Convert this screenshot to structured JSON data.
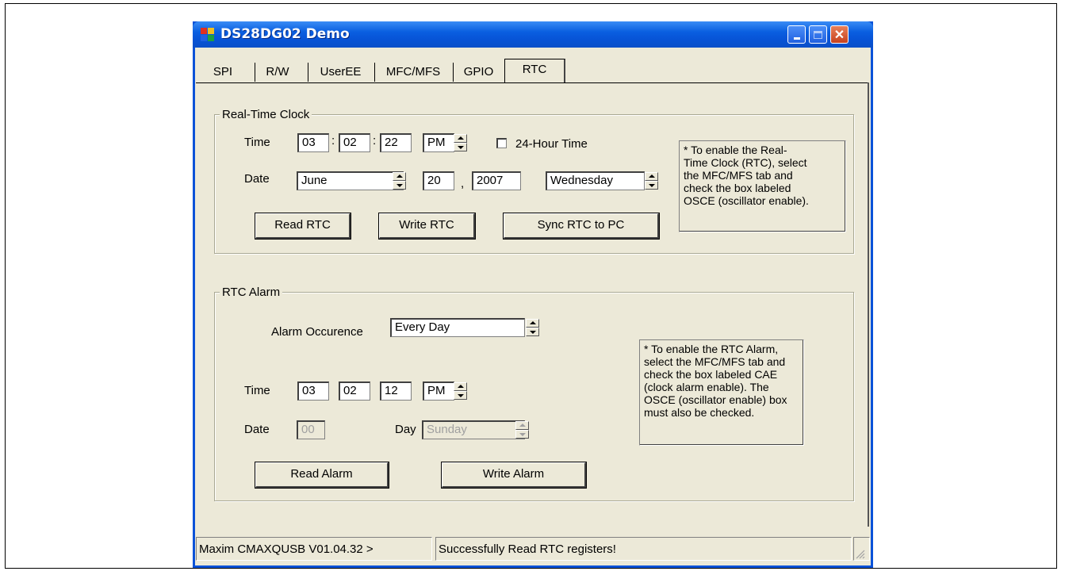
{
  "window": {
    "title": "DS28DG02 Demo"
  },
  "tabs": [
    "SPI",
    "R/W",
    "UserEE",
    "MFC/MFS",
    "GPIO",
    "RTC"
  ],
  "active_tab": "RTC",
  "rtc": {
    "group_label": "Real-Time Clock",
    "time_label": "Time",
    "hour": "03",
    "minute": "02",
    "second": "22",
    "ampm": "PM",
    "colon": ":",
    "hour24_label": "24-Hour Time",
    "date_label": "Date",
    "month": "June",
    "day": "20",
    "comma": ",",
    "year": "2007",
    "weekday": "Wednesday",
    "read_button": "Read RTC",
    "write_button": "Write RTC",
    "sync_button": "Sync RTC to PC",
    "note": [
      "* To enable the Real-",
      "Time Clock (RTC), select",
      "the MFC/MFS tab and",
      "check the box labeled",
      "OSCE (oscillator enable)."
    ]
  },
  "alarm": {
    "group_label": "RTC Alarm",
    "occurrence_label": "Alarm Occurence",
    "occurrence_value": "Every Day",
    "time_label": "Time",
    "hour": "03",
    "minute": "02",
    "second": "12",
    "ampm": "PM",
    "date_label": "Date",
    "date_value": "00",
    "day_label": "Day",
    "day_value": "Sunday",
    "read_button": "Read Alarm",
    "write_button": "Write Alarm",
    "note": [
      "* To enable the RTC Alarm,",
      "select the MFC/MFS tab and",
      "check the box labeled CAE",
      "(clock alarm enable).  The",
      "OSCE (oscillator enable) box",
      "must also be checked."
    ]
  },
  "status": {
    "left": "Maxim CMAXQUSB V01.04.32 >",
    "message": "Successfully Read RTC registers!"
  }
}
